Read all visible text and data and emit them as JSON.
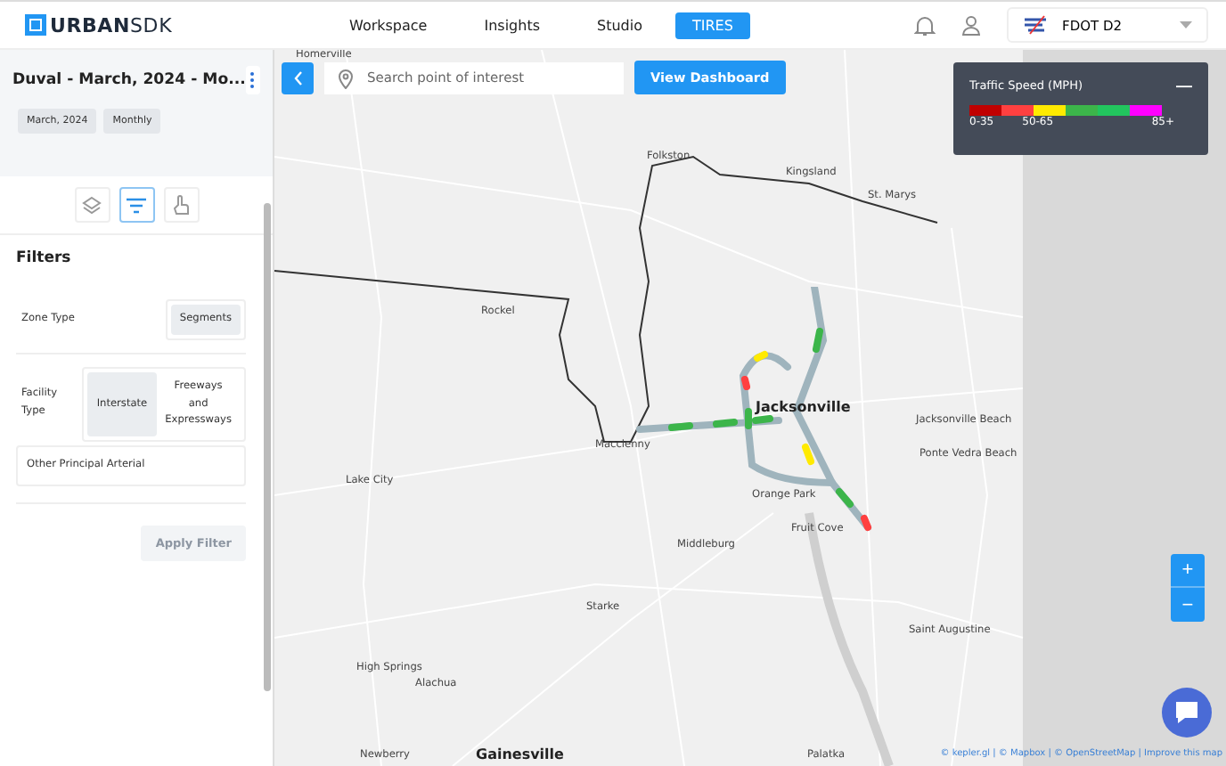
{
  "logo": "**URBAN**SDK",
  "nav": [
    {
      "label": "Workspace",
      "selected": false
    },
    {
      "label": "Insights",
      "selected": false
    },
    {
      "label": "Studio",
      "selected": false
    },
    {
      "label": "TIRES",
      "selected": true
    }
  ],
  "org_selector": {
    "value": "FDOT D2"
  },
  "sidebar": {
    "title": "Duval - March, 2024 - Mo...",
    "tags": [
      "March, 2024",
      "Monthly"
    ],
    "tools": [
      {
        "kind": "layers",
        "selected": false
      },
      {
        "kind": "filter",
        "selected": true
      },
      {
        "kind": "pointer",
        "selected": false
      }
    ],
    "filters": {
      "heading": "Filters",
      "zone_type": {
        "label": "Zone Type",
        "options": [
          {
            "label": "Segments",
            "selected": true
          }
        ]
      },
      "facility_type": {
        "label": "Facility Type",
        "options": [
          {
            "label": "Interstate",
            "selected": true
          },
          {
            "label": "Freeways and Expressways",
            "selected": false
          },
          {
            "label": "Other Principal Arterial",
            "selected": false
          }
        ]
      },
      "apply_button": {
        "label": "Apply Filter",
        "disabled": true
      }
    }
  },
  "map": {
    "search": {
      "placeholder": "Search point of interest"
    },
    "dashboard_button": "View Dashboard",
    "places": [
      {
        "name": "Homerville",
        "kind": "town"
      },
      {
        "name": "Folkston",
        "kind": "town"
      },
      {
        "name": "Kingsland",
        "kind": "town"
      },
      {
        "name": "St. Marys",
        "kind": "town"
      },
      {
        "name": "Rockel",
        "kind": "town"
      },
      {
        "name": "Jacksonville",
        "kind": "city"
      },
      {
        "name": "Jacksonville Beach",
        "kind": "town"
      },
      {
        "name": "Ponte Vedra Beach",
        "kind": "town"
      },
      {
        "name": "Macclenny",
        "kind": "town"
      },
      {
        "name": "Lake City",
        "kind": "town"
      },
      {
        "name": "Orange Park",
        "kind": "town"
      },
      {
        "name": "Fruit Cove",
        "kind": "town"
      },
      {
        "name": "Middleburg",
        "kind": "town"
      },
      {
        "name": "Starke",
        "kind": "town"
      },
      {
        "name": "Saint Augustine",
        "kind": "town"
      },
      {
        "name": "High Springs",
        "kind": "town"
      },
      {
        "name": "Alachua",
        "kind": "town"
      },
      {
        "name": "Newberry",
        "kind": "town"
      },
      {
        "name": "Gainesville",
        "kind": "city"
      },
      {
        "name": "Palatka",
        "kind": "town"
      }
    ],
    "legend": {
      "title": "Traffic Speed (MPH)",
      "collapse": "—",
      "segments": [
        {
          "color": "#c00000"
        },
        {
          "color": "#ff4040"
        },
        {
          "color": "#ffea00"
        },
        {
          "color": "#3cb54a"
        },
        {
          "color": "#22c55e"
        },
        {
          "color": "#ff00ff"
        }
      ],
      "labels": [
        "0-35",
        "50-65",
        "85+"
      ]
    },
    "zoom": [
      "+",
      "−"
    ],
    "attribution": "© kepler.gl | © Mapbox | © OpenStreetMap | Improve this map"
  }
}
